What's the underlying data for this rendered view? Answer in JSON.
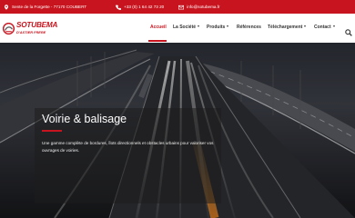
{
  "topbar": {
    "address": "Sente de la Forgette - 77170 COUBERT",
    "phone": "+33 (0) 1 64 42 73 20",
    "email": "info@sotubema.fr"
  },
  "logo": {
    "brand": "SOTUBEMA",
    "tagline": "D'ASTIER FRERE"
  },
  "nav": {
    "items": [
      {
        "label": "Accueil",
        "active": true,
        "dropdown": false
      },
      {
        "label": "La Société",
        "active": false,
        "dropdown": true
      },
      {
        "label": "Produits",
        "active": false,
        "dropdown": true
      },
      {
        "label": "Références",
        "active": false,
        "dropdown": false
      },
      {
        "label": "Téléchargement",
        "active": false,
        "dropdown": true
      },
      {
        "label": "Contact",
        "active": false,
        "dropdown": true
      }
    ],
    "search_icon": "search-icon"
  },
  "hero": {
    "title": "Voirie & balisage",
    "description": "Une gamme complète de bordures, îlots directionnels et obstacles urbains pour valoriser vos ouvrages de voiries."
  },
  "colors": {
    "accent": "#c8141e",
    "topbar_text": "#ffffff",
    "nav_text": "#333333"
  }
}
